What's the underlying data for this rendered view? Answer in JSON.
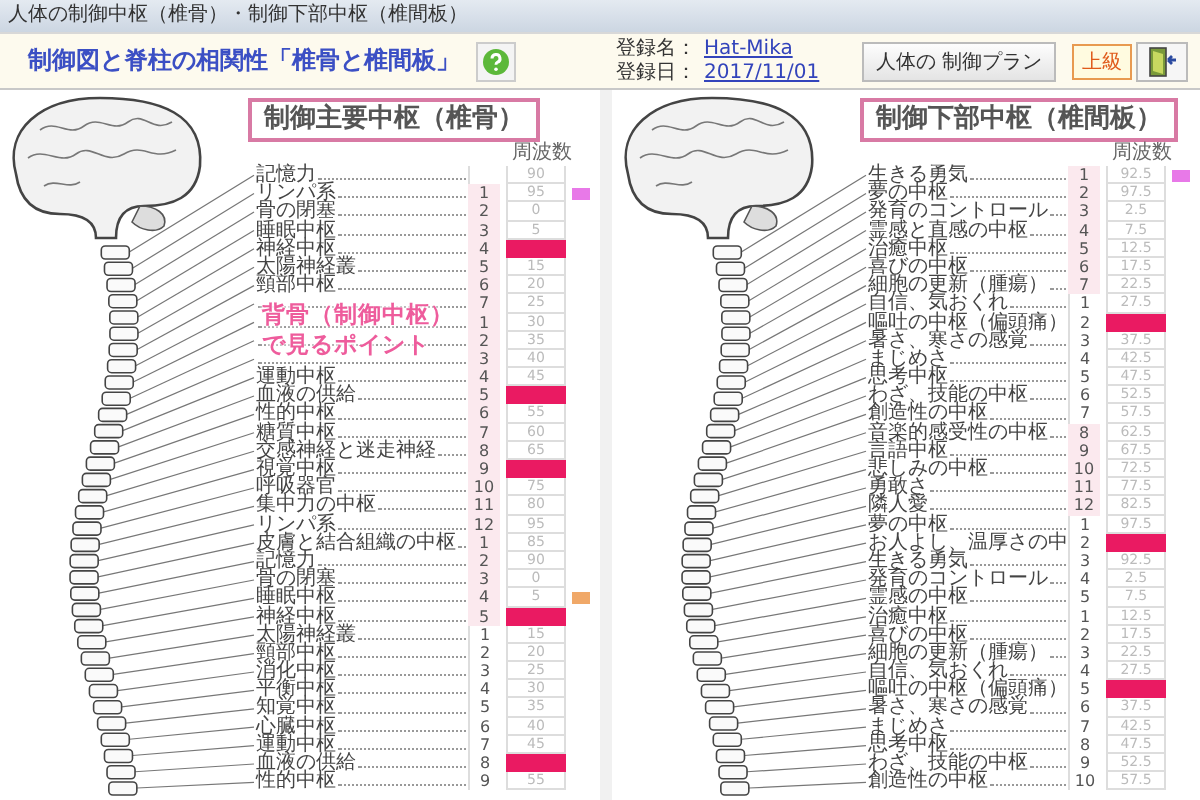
{
  "window": {
    "title": "人体の制御中枢（椎骨）・制御下部中枢（椎間板）"
  },
  "toolbar": {
    "heading": "制御図と脊柱の相関性「椎骨と椎間板」",
    "registrant_label": "登録名：",
    "registrant": "Hat-Mika",
    "date_label": "登録日：",
    "date": "2017/11/01",
    "plan_button": "人体の 制御プラン",
    "level_badge": "上級"
  },
  "panels": [
    {
      "title": "制御主要中枢（椎骨）",
      "frequency_header": "周波数",
      "callout": "背骨（制御中枢）で見るポイント",
      "rows": [
        {
          "label": "記憶力",
          "frequency": "90",
          "highlighted": false,
          "shaded": false
        },
        {
          "label": "リンパ系",
          "number": "1",
          "frequency": "95",
          "highlighted": false,
          "shaded": true,
          "color": "#e879e8"
        },
        {
          "label": "骨の閉塞",
          "number": "2",
          "frequency": "0",
          "highlighted": false,
          "shaded": true
        },
        {
          "label": "睡眠中枢",
          "number": "3",
          "frequency": "5",
          "highlighted": false,
          "shaded": true
        },
        {
          "label": "神経中枢",
          "number": "4",
          "highlighted": true,
          "shaded": true
        },
        {
          "label": "太陽神経叢",
          "number": "5",
          "frequency": "15",
          "highlighted": false,
          "shaded": true
        },
        {
          "label": "頸部中枢",
          "number": "6",
          "frequency": "20",
          "highlighted": false,
          "shaded": true
        },
        {
          "number": "7",
          "frequency": "25",
          "highlighted": false,
          "shaded": true
        },
        {
          "number": "1",
          "frequency": "30",
          "highlighted": false,
          "shaded": true
        },
        {
          "number": "2",
          "frequency": "35",
          "highlighted": false,
          "shaded": true
        },
        {
          "number": "3",
          "frequency": "40",
          "highlighted": false,
          "shaded": true
        },
        {
          "label": "運動中枢",
          "number": "4",
          "frequency": "45",
          "highlighted": false,
          "shaded": true
        },
        {
          "label": "血液の供給",
          "number": "5",
          "highlighted": true,
          "shaded": true
        },
        {
          "label": "性的中枢",
          "number": "6",
          "frequency": "55",
          "highlighted": false,
          "shaded": true
        },
        {
          "label": "糖質中枢",
          "number": "7",
          "frequency": "60",
          "highlighted": false,
          "shaded": true
        },
        {
          "label": "交感神経と迷走神経",
          "number": "8",
          "frequency": "65",
          "highlighted": false,
          "shaded": true
        },
        {
          "label": "視覚中枢",
          "number": "9",
          "highlighted": true,
          "shaded": true
        },
        {
          "label": "呼吸器官",
          "number": "10",
          "frequency": "75",
          "highlighted": false,
          "shaded": true
        },
        {
          "label": "集中力の中枢",
          "number": "11",
          "frequency": "80",
          "highlighted": false,
          "shaded": true
        },
        {
          "label": "リンパ系",
          "number": "12",
          "frequency": "95",
          "highlighted": false,
          "shaded": true
        },
        {
          "label": "皮膚と結合組織の中枢",
          "number": "1",
          "frequency": "85",
          "highlighted": false,
          "shaded": true
        },
        {
          "label": "記憶力",
          "number": "2",
          "frequency": "90",
          "highlighted": false,
          "shaded": true
        },
        {
          "label": "骨の閉塞",
          "number": "3",
          "frequency": "0",
          "highlighted": false,
          "shaded": true
        },
        {
          "label": "睡眠中枢",
          "number": "4",
          "frequency": "5",
          "highlighted": false,
          "shaded": true,
          "color": "#f0a868"
        },
        {
          "label": "神経中枢",
          "number": "5",
          "highlighted": true,
          "shaded": true
        },
        {
          "label": "太陽神経叢",
          "number": "1",
          "frequency": "15",
          "highlighted": false,
          "shaded": false
        },
        {
          "label": "頸部中枢",
          "number": "2",
          "frequency": "20",
          "highlighted": false,
          "shaded": false
        },
        {
          "label": "消化中枢",
          "number": "3",
          "frequency": "25",
          "highlighted": false,
          "shaded": false
        },
        {
          "label": "平衡中枢",
          "number": "4",
          "frequency": "30",
          "highlighted": false,
          "shaded": false
        },
        {
          "label": "知覚中枢",
          "number": "5",
          "frequency": "35",
          "highlighted": false,
          "shaded": false
        },
        {
          "label": "心臓中枢",
          "number": "6",
          "frequency": "40",
          "highlighted": false,
          "shaded": false
        },
        {
          "label": "運動中枢",
          "number": "7",
          "frequency": "45",
          "highlighted": false,
          "shaded": false
        },
        {
          "label": "血液の供給",
          "number": "8",
          "highlighted": true,
          "shaded": false
        },
        {
          "label": "性的中枢",
          "number": "9",
          "frequency": "55",
          "highlighted": false,
          "shaded": false
        }
      ]
    },
    {
      "title": "制御下部中枢（椎間板）",
      "frequency_header": "周波数",
      "rows": [
        {
          "label": "生きる勇気",
          "number": "1",
          "frequency": "92.5",
          "highlighted": false,
          "shaded": true,
          "color": "#e879e8"
        },
        {
          "label": "夢の中枢",
          "number": "2",
          "frequency": "97.5",
          "highlighted": false,
          "shaded": true
        },
        {
          "label": "発育のコントロール",
          "number": "3",
          "frequency": "2.5",
          "highlighted": false,
          "shaded": true
        },
        {
          "label": "霊感と直感の中枢",
          "number": "4",
          "frequency": "7.5",
          "highlighted": false,
          "shaded": true
        },
        {
          "label": "治癒中枢",
          "number": "5",
          "frequency": "12.5",
          "highlighted": false,
          "shaded": true
        },
        {
          "label": "喜びの中枢",
          "number": "6",
          "frequency": "17.5",
          "highlighted": false,
          "shaded": true
        },
        {
          "label": "細胞の更新（腫瘍）",
          "number": "7",
          "frequency": "22.5",
          "highlighted": false,
          "shaded": true
        },
        {
          "label": "自信、気おくれ",
          "number": "1",
          "frequency": "27.5",
          "highlighted": false,
          "shaded": false
        },
        {
          "label": "嘔吐の中枢（偏頭痛）",
          "number": "2",
          "highlighted": true,
          "shaded": false
        },
        {
          "label": "暑さ、寒さの感覚",
          "number": "3",
          "frequency": "37.5",
          "highlighted": false,
          "shaded": false
        },
        {
          "label": "まじめさ",
          "number": "4",
          "frequency": "42.5",
          "highlighted": false,
          "shaded": false
        },
        {
          "label": "思考中枢",
          "number": "5",
          "frequency": "47.5",
          "highlighted": false,
          "shaded": false
        },
        {
          "label": "わざ、技能の中枢",
          "number": "6",
          "frequency": "52.5",
          "highlighted": false,
          "shaded": false
        },
        {
          "label": "創造性の中枢",
          "number": "7",
          "frequency": "57.5",
          "highlighted": false,
          "shaded": false
        },
        {
          "label": "音楽的感受性の中枢",
          "number": "8",
          "frequency": "62.5",
          "highlighted": false,
          "shaded": true
        },
        {
          "label": "言語中枢",
          "number": "9",
          "frequency": "67.5",
          "highlighted": false,
          "shaded": true
        },
        {
          "label": "悲しみの中枢",
          "number": "10",
          "frequency": "72.5",
          "highlighted": false,
          "shaded": true
        },
        {
          "label": "勇敢さ",
          "number": "11",
          "frequency": "77.5",
          "highlighted": false,
          "shaded": true
        },
        {
          "label": "隣人愛",
          "number": "12",
          "frequency": "82.5",
          "highlighted": false,
          "shaded": true
        },
        {
          "label": "夢の中枢",
          "number": "1",
          "frequency": "97.5",
          "highlighted": false,
          "shaded": false
        },
        {
          "label": "お人よし、温厚さの中",
          "number": "2",
          "highlighted": true,
          "shaded": false
        },
        {
          "label": "生きる勇気",
          "number": "3",
          "frequency": "92.5",
          "highlighted": false,
          "shaded": false
        },
        {
          "label": "発育のコントロール",
          "number": "4",
          "frequency": "2.5",
          "highlighted": false,
          "shaded": false
        },
        {
          "label": "霊感の中枢",
          "number": "5",
          "frequency": "7.5",
          "highlighted": false,
          "shaded": false
        },
        {
          "label": "治癒中枢",
          "number": "1",
          "frequency": "12.5",
          "highlighted": false,
          "shaded": false
        },
        {
          "label": "喜びの中枢",
          "number": "2",
          "frequency": "17.5",
          "highlighted": false,
          "shaded": false
        },
        {
          "label": "細胞の更新（腫瘍）",
          "number": "3",
          "frequency": "22.5",
          "highlighted": false,
          "shaded": false
        },
        {
          "label": "自信、気おくれ",
          "number": "4",
          "frequency": "27.5",
          "highlighted": false,
          "shaded": false
        },
        {
          "label": "嘔吐の中枢（偏頭痛）",
          "number": "5",
          "highlighted": true,
          "shaded": false
        },
        {
          "label": "暑さ、寒さの感覚",
          "number": "6",
          "frequency": "37.5",
          "highlighted": false,
          "shaded": false
        },
        {
          "label": "まじめさ",
          "number": "7",
          "frequency": "42.5",
          "highlighted": false,
          "shaded": false
        },
        {
          "label": "思考中枢",
          "number": "8",
          "frequency": "47.5",
          "highlighted": false,
          "shaded": false
        },
        {
          "label": "わざ、技能の中枢",
          "number": "9",
          "frequency": "52.5",
          "highlighted": false,
          "shaded": false
        },
        {
          "label": "創造性の中枢",
          "number": "10",
          "frequency": "57.5",
          "highlighted": false,
          "shaded": false
        }
      ]
    }
  ]
}
